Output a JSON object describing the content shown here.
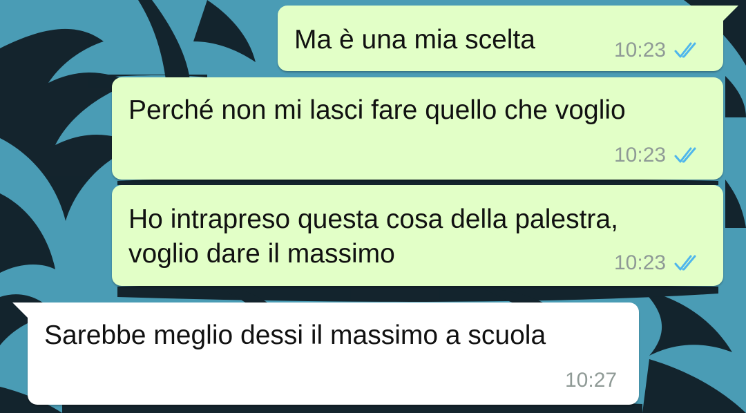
{
  "chat": {
    "messages": [
      {
        "direction": "outgoing",
        "text": "Ma è una mia scelta",
        "time": "10:23",
        "status": "read-double-check-icon"
      },
      {
        "direction": "outgoing",
        "text": "Perché non mi lasci fare quello che voglio",
        "time": "10:23",
        "status": "read-double-check-icon"
      },
      {
        "direction": "outgoing",
        "text_lines": [
          "Ho intrapreso questa cosa della palestra,",
          "voglio dare il massimo"
        ],
        "time": "10:23",
        "status": "read-double-check-icon"
      },
      {
        "direction": "incoming",
        "text": "Sarebbe meglio dessi il massimo a scuola",
        "time": "10:27"
      }
    ]
  },
  "colors": {
    "wallpaper": "#4a9cb5",
    "outgoing_bubble": "#e2ffc7",
    "incoming_bubble": "#ffffff",
    "read_ticks": "#4fb6ec",
    "time_text": "#8f9a96"
  }
}
